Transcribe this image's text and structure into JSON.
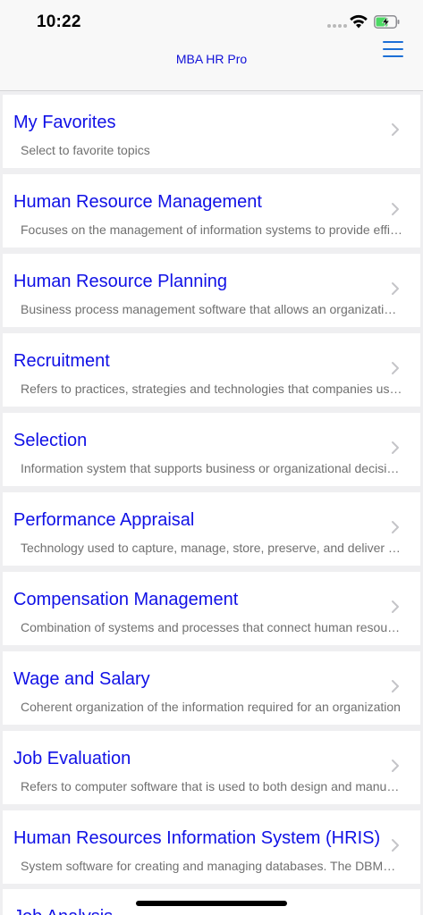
{
  "status_bar": {
    "time": "10:22",
    "icons": [
      "cellular-signal-icon",
      "wifi-icon",
      "battery-charging-icon"
    ]
  },
  "nav": {
    "title": "MBA HR Pro",
    "menu_icon": "hamburger-menu-icon"
  },
  "colors": {
    "title_text": "#1010e6",
    "accent_blue": "#1c6fd6",
    "battery_green": "#4cd964"
  },
  "items": [
    {
      "title": "My Favorites",
      "subtitle": "Select to favorite topics"
    },
    {
      "title": "Human Resource Management",
      "subtitle": "Focuses on the management of information systems to provide efficient and effective services"
    },
    {
      "title": "Human Resource Planning",
      "subtitle": "Business process management software that allows an organization to plan its workforce"
    },
    {
      "title": "Recruitment",
      "subtitle": "Refers to practices, strategies and technologies that companies use to attract candidates"
    },
    {
      "title": "Selection",
      "subtitle": "Information system that supports business or organizational decision-making activities"
    },
    {
      "title": "Performance Appraisal",
      "subtitle": "Technology used to capture, manage, store, preserve, and deliver content"
    },
    {
      "title": "Compensation Management",
      "subtitle": "Combination of systems and processes that connect human resource management"
    },
    {
      "title": "Wage and Salary",
      "subtitle": "Coherent organization of the information required for an organization"
    },
    {
      "title": "Job Evaluation",
      "subtitle": "Refers to computer software that is used to both design and manufacture"
    },
    {
      "title": "Human Resources Information System (HRIS)",
      "subtitle": "System software for creating and managing databases. The DBMS provides users"
    },
    {
      "title": "Job Analysis",
      "subtitle": ""
    }
  ]
}
